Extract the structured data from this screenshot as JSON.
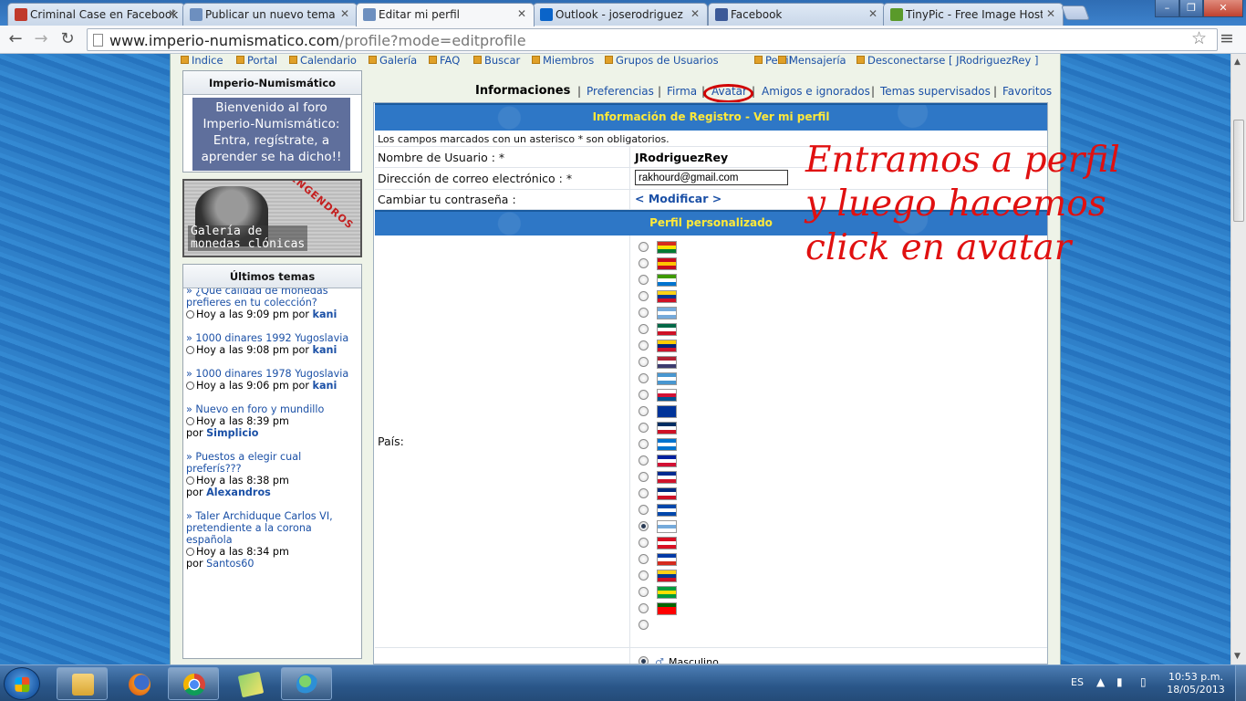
{
  "browser": {
    "tabs": [
      {
        "title": "Criminal Case en Facebook",
        "icon": "game-favicon",
        "color": "#c0392b"
      },
      {
        "title": "Publicar un nuevo tema",
        "icon": "chrome-page-favicon",
        "color": "#6d8fbf"
      },
      {
        "title": "Editar mi perfil",
        "icon": "chrome-page-favicon",
        "color": "#6d8fbf",
        "active": true
      },
      {
        "title": "Outlook - joserodriguezrey@",
        "icon": "outlook-favicon",
        "color": "#0a64c9"
      },
      {
        "title": "Facebook",
        "icon": "facebook-favicon",
        "color": "#3b5998"
      },
      {
        "title": "TinyPic - Free Image Hosting",
        "icon": "tinypic-favicon",
        "color": "#5a9a2a"
      }
    ],
    "url_host": "www.imperio-numismatico.com",
    "url_path": "/profile?mode=editprofile",
    "window_buttons": {
      "minimize": "–",
      "maximize": "❐",
      "close": "✕"
    }
  },
  "site": {
    "nav": [
      "Indice",
      "Portal",
      "Calendario",
      "Galería",
      "FAQ",
      "Buscar",
      "Miembros",
      "Grupos de Usuarios",
      "Perfil",
      "Mensajería",
      "Desconectarse [ JRodriguezRey ]"
    ],
    "welcome": {
      "title": "Imperio-Numismático",
      "message": [
        "Bienvenido al foro",
        "Imperio-Numismático:",
        "Entra, regístrate, a",
        "aprender se ha dicho!!"
      ]
    },
    "gallery_banner": {
      "ribbon": "ENGENDROS",
      "caption_1": "Galería de",
      "caption_2": "monedas clónicas"
    },
    "latest": {
      "title": "Últimos temas",
      "topics": [
        {
          "title_1": "» ¿Qué calidad de monedas",
          "title_2": "prefieres en tu colección?",
          "time": "Hoy a las 9:09 pm por",
          "author": "kani"
        },
        {
          "title_1": "» 1000 dinares 1992 Yugoslavia",
          "time": "Hoy a las 9:08 pm por",
          "author": "kani"
        },
        {
          "title_1": "» 1000 dinares 1978 Yugoslavia",
          "time": "Hoy a las 9:06 pm por",
          "author": "kani"
        },
        {
          "title_1": "» Nuevo en foro y mundillo",
          "time": "Hoy a las 8:39 pm",
          "prefix": "por",
          "author": "Simplicio"
        },
        {
          "title_1": "» Puestos a elegir cual",
          "title_2": "preferís???",
          "time": "Hoy a las 8:38 pm",
          "prefix": "por",
          "author": "Alexandros"
        },
        {
          "title_1": "» Taler Archiduque Carlos VI,",
          "title_2": "pretendiente a la corona",
          "title_3": "española",
          "time": "Hoy a las 8:34 pm",
          "prefix": "por",
          "author": "Santos60"
        }
      ]
    },
    "profile_tabs": {
      "current": "Informaciones",
      "links": [
        "Preferencias",
        "Firma",
        "Avatar",
        "Amigos e ignorados",
        "Temas supervisados",
        "Favoritos"
      ],
      "separator": "|"
    },
    "form": {
      "header": "Información de Registro - Ver mi perfil",
      "notice": "Los campos marcados con un asterisco * son obligatorios.",
      "username_label": "Nombre de Usuario : *",
      "username_value": "JRodriguezRey",
      "email_label": "Dirección de correo electrónico : *",
      "email_value": "rakhourd@gmail.com",
      "password_label": "Cambiar tu contraseña :",
      "password_link": "< Modificar >",
      "custom_header": "Perfil personalizado",
      "country_label": "País:",
      "country_selected_index": 17,
      "flags": [
        [
          "#d52b1e",
          "#f9e300",
          "#007a33"
        ],
        [
          "#c60b1e",
          "#ffc400",
          "#c60b1e"
        ],
        [
          "#3e9a00",
          "#ffffff",
          "#0073ce"
        ],
        [
          "#fcd116",
          "#003893",
          "#ce1126"
        ],
        [
          "#75aadb",
          "#ffffff",
          "#75aadb"
        ],
        [
          "#006847",
          "#ffffff",
          "#ce1126"
        ],
        [
          "#ffcc00",
          "#00247d",
          "#cf142b"
        ],
        [
          "#b22234",
          "#ffffff",
          "#3c3b6e"
        ],
        [
          "#4997d0",
          "#ffffff",
          "#4997d0"
        ],
        [
          "#ffffff",
          "#d21034",
          "#005293"
        ],
        [
          "#003399",
          "#003399",
          "#003399"
        ],
        [
          "#002d62",
          "#ffffff",
          "#ce1126"
        ],
        [
          "#0073cf",
          "#ffffff",
          "#0073cf"
        ],
        [
          "#00209f",
          "#ffffff",
          "#d21034"
        ],
        [
          "#002a8f",
          "#ffffff",
          "#cf142b"
        ],
        [
          "#002b7f",
          "#ffffff",
          "#ce1126"
        ],
        [
          "#0047ab",
          "#ffffff",
          "#0047ab"
        ],
        [
          "#ffffff",
          "#75aadb",
          "#ffffff"
        ],
        [
          "#d91023",
          "#ffffff",
          "#d91023"
        ],
        [
          "#0039a6",
          "#ffffff",
          "#d52b1e"
        ],
        [
          "#fcd116",
          "#003893",
          "#ce1126"
        ],
        [
          "#009c3b",
          "#ffdf00",
          "#009c3b"
        ],
        [
          "#006600",
          "#ff0000",
          "#ff0000"
        ]
      ],
      "gender_label": "Masculino",
      "gender_icon": "male-icon"
    }
  },
  "annotation": {
    "line_1": "Entramos a perfil",
    "line_2": "y luego hacemos",
    "line_3": "click en avatar",
    "color": "#e01010"
  },
  "taskbar": {
    "apps": [
      "explorer-icon",
      "firefox-icon",
      "chrome-icon",
      "notes-icon",
      "messenger-icon"
    ],
    "language": "ES",
    "time": "10:53 p.m.",
    "date": "18/05/2013"
  }
}
